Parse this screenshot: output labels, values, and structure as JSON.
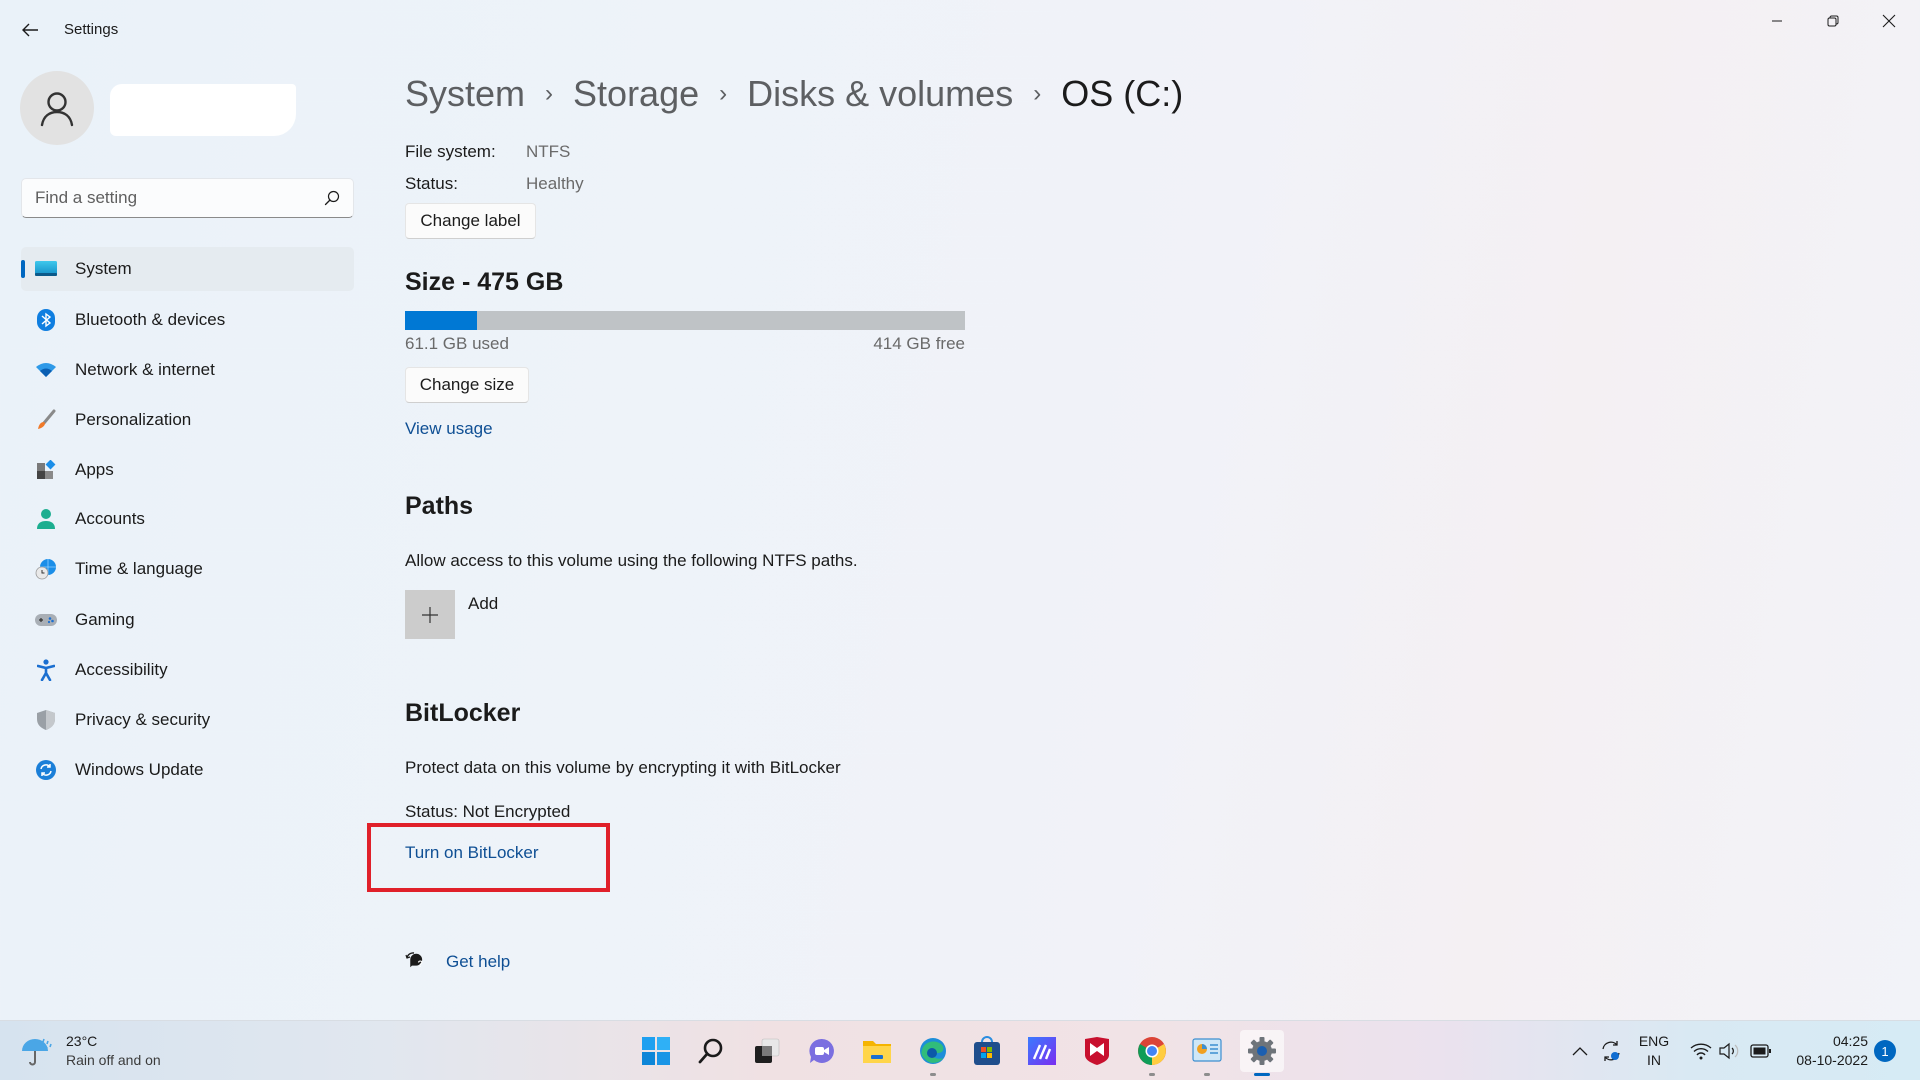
{
  "window": {
    "title": "Settings",
    "back_icon": "back-arrow-icon",
    "controls": {
      "minimize": "minimize-icon",
      "maximize": "restore-icon",
      "close": "close-icon"
    }
  },
  "profile": {
    "avatar_icon": "person-icon",
    "name": ""
  },
  "search": {
    "placeholder": "Find a setting",
    "value": "",
    "icon": "search-icon"
  },
  "sidebar": {
    "selected": "System",
    "accent": "#0067c0",
    "items": [
      {
        "label": "System",
        "icon": "system-monitor-icon"
      },
      {
        "label": "Bluetooth & devices",
        "icon": "bluetooth-icon"
      },
      {
        "label": "Network & internet",
        "icon": "wifi-icon"
      },
      {
        "label": "Personalization",
        "icon": "paintbrush-icon"
      },
      {
        "label": "Apps",
        "icon": "apps-icon"
      },
      {
        "label": "Accounts",
        "icon": "account-icon"
      },
      {
        "label": "Time & language",
        "icon": "globe-clock-icon"
      },
      {
        "label": "Gaming",
        "icon": "gamepad-icon"
      },
      {
        "label": "Accessibility",
        "icon": "accessibility-icon"
      },
      {
        "label": "Privacy & security",
        "icon": "shield-icon"
      },
      {
        "label": "Windows Update",
        "icon": "update-icon"
      }
    ]
  },
  "breadcrumb": {
    "items": [
      "System",
      "Storage",
      "Disks & volumes",
      "OS (C:)"
    ],
    "separator": "›"
  },
  "volume": {
    "file_system_label": "File system:",
    "file_system_value": "NTFS",
    "status_label": "Status:",
    "status_value": "Healthy",
    "change_label_button": "Change label"
  },
  "size": {
    "title": "Size - 475 GB",
    "total_gb": 475,
    "used_gb": 61.1,
    "free_gb": 414,
    "used_fraction": 0.1286,
    "used_text": "61.1 GB used",
    "free_text": "414 GB free",
    "change_size_button": "Change size",
    "view_usage_link": "View usage",
    "used_color": "#0078d4",
    "track_color": "#bfc3c6"
  },
  "paths": {
    "title": "Paths",
    "description": "Allow access to this volume using the following NTFS paths.",
    "add_label": "Add",
    "add_icon": "plus-icon"
  },
  "bitlocker": {
    "title": "BitLocker",
    "description": "Protect data on this volume by encrypting it with BitLocker",
    "status": "Status: Not Encrypted",
    "turn_on_link": "Turn on BitLocker",
    "highlight_color": "#e0202a"
  },
  "help": {
    "label": "Get help",
    "icon": "help-chat-icon"
  },
  "taskbar": {
    "weather": {
      "temp": "23°C",
      "condition": "Rain off and on",
      "icon": "rain-umbrella-icon"
    },
    "apps": [
      {
        "name": "start",
        "icon": "windows-start-icon",
        "state": "none"
      },
      {
        "name": "search",
        "icon": "search-icon",
        "state": "none"
      },
      {
        "name": "task-view",
        "icon": "task-view-icon",
        "state": "none"
      },
      {
        "name": "chat",
        "icon": "teams-chat-icon",
        "state": "none"
      },
      {
        "name": "file-explorer",
        "icon": "folder-icon",
        "state": "none"
      },
      {
        "name": "edge",
        "icon": "edge-browser-icon",
        "state": "running"
      },
      {
        "name": "store",
        "icon": "store-icon",
        "state": "none"
      },
      {
        "name": "mcafee-ai",
        "icon": "ai-app-icon",
        "state": "none"
      },
      {
        "name": "mcafee",
        "icon": "mcafee-shield-icon",
        "state": "none"
      },
      {
        "name": "chrome",
        "icon": "chrome-icon",
        "state": "running"
      },
      {
        "name": "control-panel",
        "icon": "control-panel-icon",
        "state": "running"
      },
      {
        "name": "settings",
        "icon": "settings-gear-icon",
        "state": "active"
      }
    ],
    "tray": {
      "overflow_icon": "chevron-up-icon",
      "sync_icon": "sync-icon",
      "lang_line1": "ENG",
      "lang_line2": "IN",
      "wifi_icon": "wifi-icon",
      "volume_icon": "volume-icon",
      "battery_icon": "battery-icon",
      "time": "04:25",
      "date": "08-10-2022",
      "notification_count": "1"
    }
  }
}
